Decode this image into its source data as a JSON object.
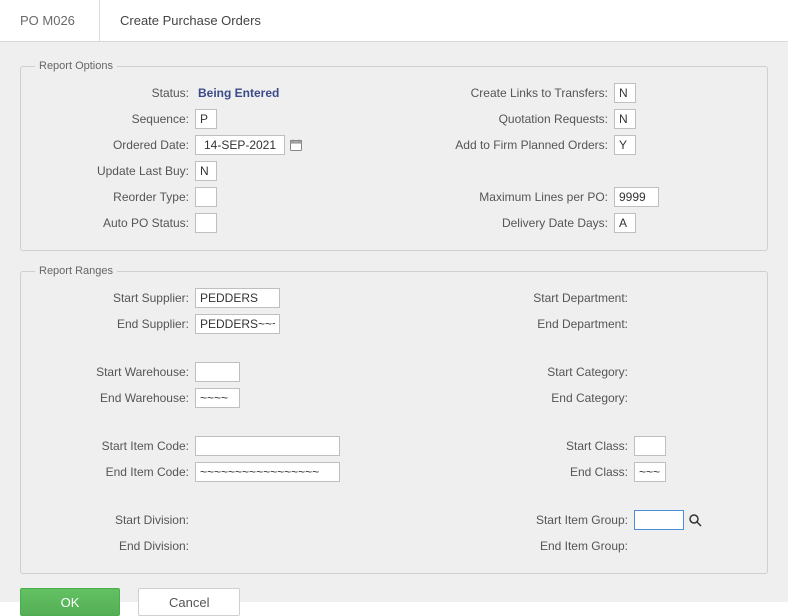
{
  "header": {
    "code": "PO M026",
    "title": "Create Purchase Orders"
  },
  "panels": {
    "options": {
      "legend": "Report Options"
    },
    "ranges": {
      "legend": "Report Ranges"
    }
  },
  "options": {
    "status_label": "Status:",
    "status_value": "Being Entered",
    "sequence_label": "Sequence:",
    "sequence_value": "P",
    "ordered_date_label": "Ordered Date:",
    "ordered_date_value": "14-SEP-2021",
    "update_last_buy_label": "Update Last Buy:",
    "update_last_buy_value": "N",
    "reorder_type_label": "Reorder Type:",
    "reorder_type_value": "",
    "auto_po_status_label": "Auto PO Status:",
    "auto_po_status_value": "",
    "create_links_label": "Create Links to Transfers:",
    "create_links_value": "N",
    "quotation_label": "Quotation Requests:",
    "quotation_value": "N",
    "add_firm_label": "Add to Firm Planned Orders:",
    "add_firm_value": "Y",
    "max_lines_label": "Maximum Lines per PO:",
    "max_lines_value": "9999",
    "delivery_days_label": "Delivery Date Days:",
    "delivery_days_value": "A"
  },
  "ranges": {
    "start_supplier_label": "Start Supplier:",
    "start_supplier_value": "PEDDERS",
    "end_supplier_label": "End Supplier:",
    "end_supplier_value": "PEDDERS~~~",
    "start_warehouse_label": "Start Warehouse:",
    "start_warehouse_value": "",
    "end_warehouse_label": "End Warehouse:",
    "end_warehouse_value": "~~~~",
    "start_item_code_label": "Start Item Code:",
    "start_item_code_value": "",
    "end_item_code_label": "End Item Code:",
    "end_item_code_value": "~~~~~~~~~~~~~~~~~",
    "start_division_label": "Start Division:",
    "end_division_label": "End Division:",
    "start_department_label": "Start Department:",
    "end_department_label": "End Department:",
    "start_category_label": "Start Category:",
    "end_category_label": "End Category:",
    "start_class_label": "Start Class:",
    "start_class_value": "",
    "end_class_label": "End Class:",
    "end_class_value": "~~~",
    "start_item_group_label": "Start Item Group:",
    "start_item_group_value": "",
    "end_item_group_label": "End Item Group:"
  },
  "buttons": {
    "ok": "OK",
    "cancel": "Cancel"
  }
}
